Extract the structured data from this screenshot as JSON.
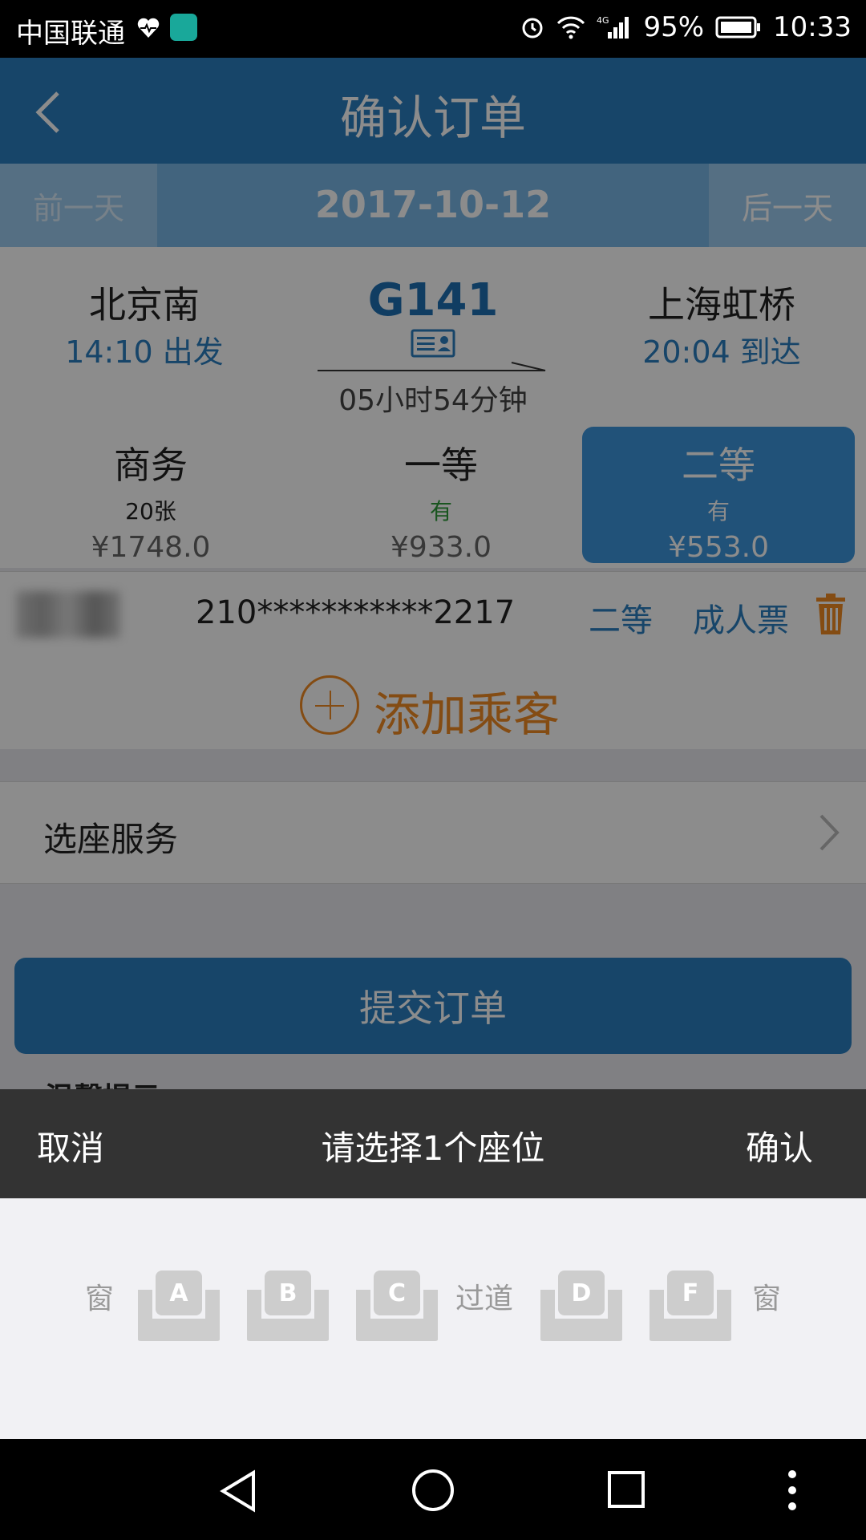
{
  "status_bar": {
    "carrier": "中国联通",
    "battery": "95%",
    "time": "10:33",
    "network": "4G"
  },
  "header": {
    "title": "确认订单"
  },
  "date_bar": {
    "prev_label": "前一天",
    "date": "2017-10-12",
    "next_label": "后一天"
  },
  "train": {
    "from_station": "北京南",
    "depart_time": "14:10 出发",
    "train_no": "G141",
    "duration": "05小时54分钟",
    "to_station": "上海虹桥",
    "arrive_time": "20:04 到达"
  },
  "seat_classes": [
    {
      "name": "商务",
      "availability": "20张",
      "price": "¥1748.0"
    },
    {
      "name": "一等",
      "availability": "有",
      "price": "¥933.0"
    },
    {
      "name": "二等",
      "availability": "有",
      "price": "¥553.0",
      "selected": true
    }
  ],
  "passenger": {
    "id_number": "210***********2217",
    "seat_class": "二等",
    "ticket_type": "成人票"
  },
  "add_passenger_label": "添加乘客",
  "seat_service_label": "选座服务",
  "submit_label": "提交订单",
  "tips_label": "温馨提示",
  "seat_picker": {
    "cancel_label": "取消",
    "prompt": "请选择1个座位",
    "confirm_label": "确认",
    "left_side_label": "窗",
    "aisle_label": "过道",
    "right_side_label": "窗",
    "seats": [
      "A",
      "B",
      "C",
      "D",
      "F"
    ]
  },
  "colors": {
    "primary": "#2a7ec0",
    "accent": "#f08a24",
    "sheet_header": "#333333"
  }
}
